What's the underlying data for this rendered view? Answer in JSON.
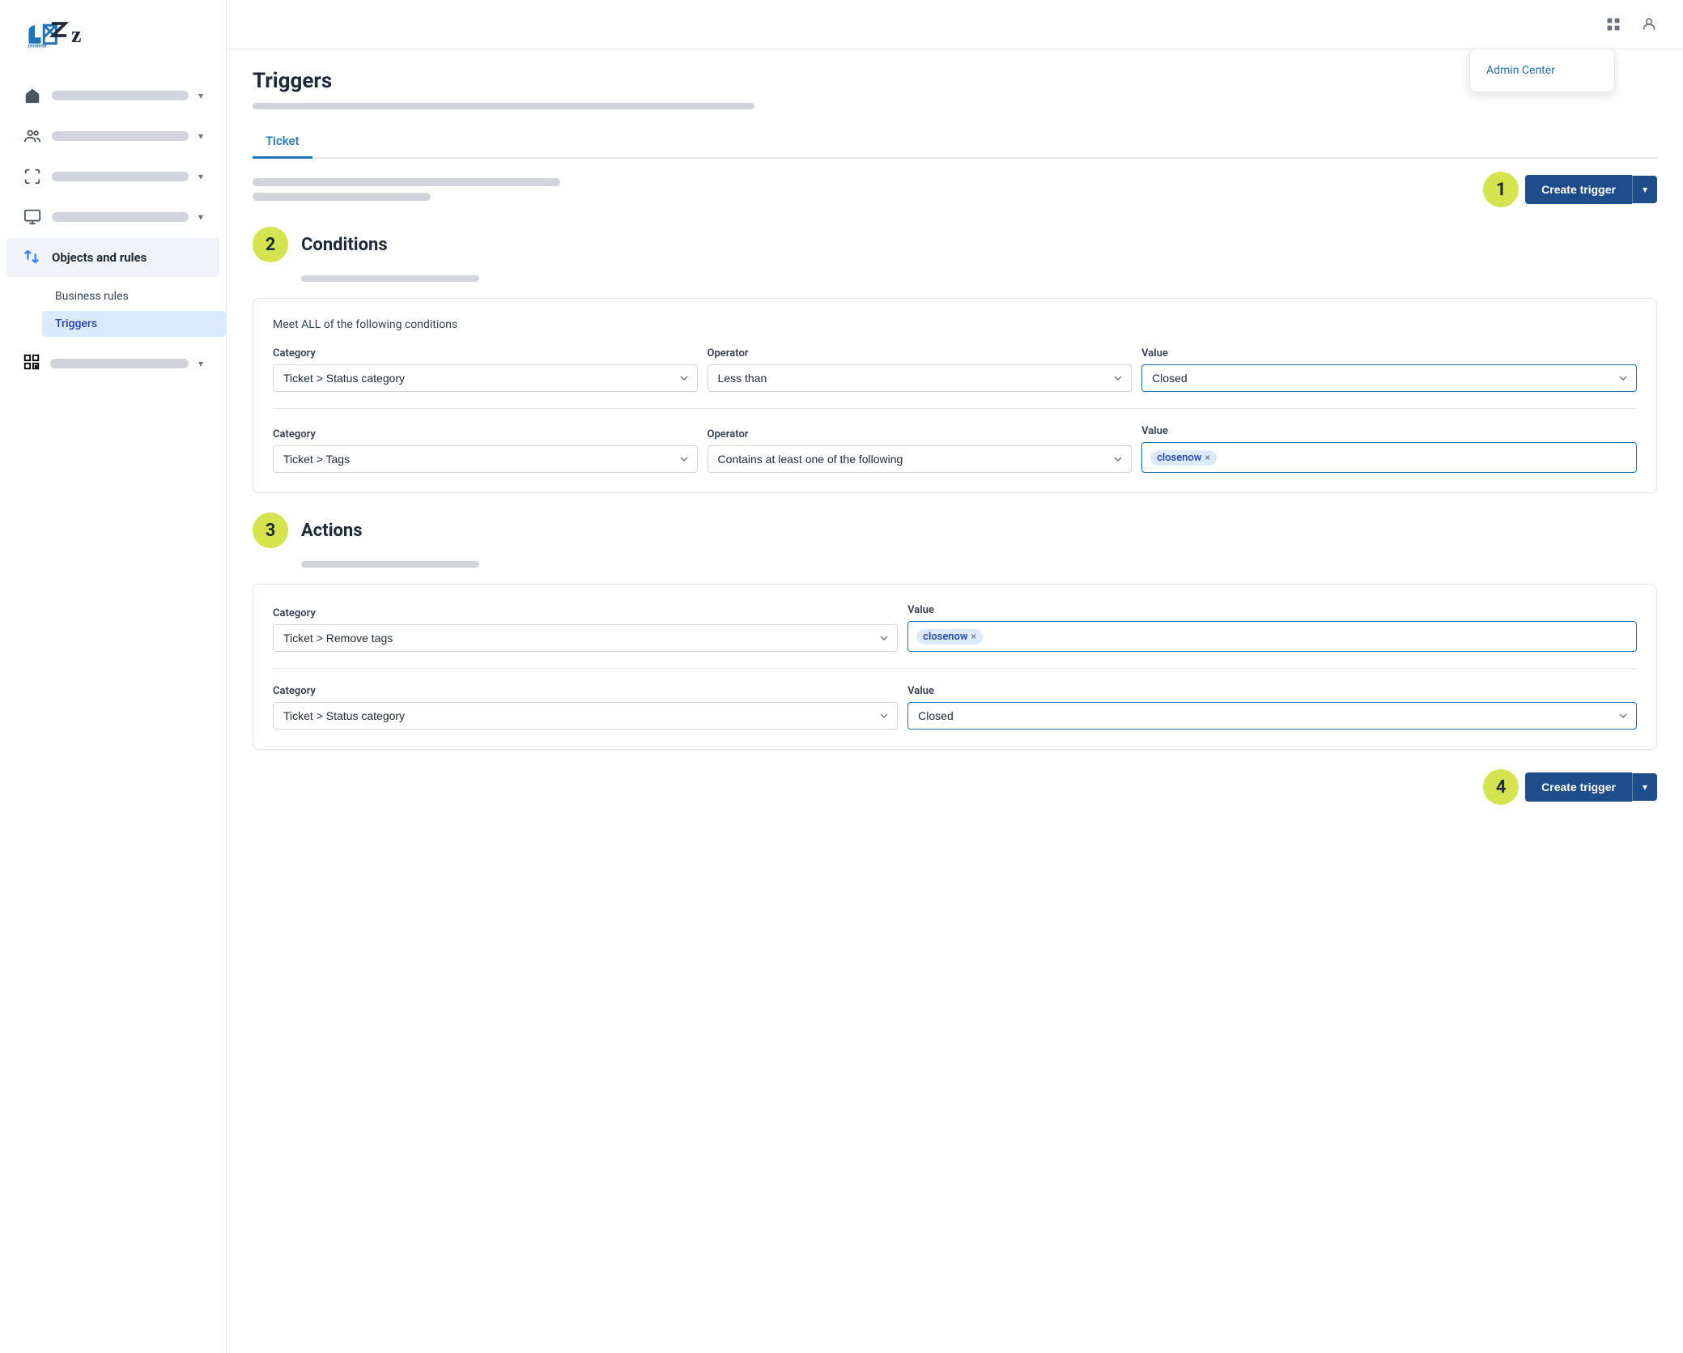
{
  "sidebar": {
    "logo_alt": "Zendesk logo",
    "nav_items": [
      {
        "id": "home",
        "icon": "🏢",
        "active": false
      },
      {
        "id": "people",
        "icon": "👥",
        "active": false
      },
      {
        "id": "channels",
        "icon": "↔",
        "active": false
      },
      {
        "id": "workspace",
        "icon": "🖥",
        "active": false
      },
      {
        "id": "objects-rules",
        "icon": "⇄",
        "label": "Objects and rules",
        "active": true
      },
      {
        "id": "apps",
        "icon": "⊞",
        "active": false
      }
    ],
    "sub_items": [
      {
        "id": "business-rules",
        "label": "Business rules",
        "active": false
      },
      {
        "id": "triggers",
        "label": "Triggers",
        "active": true
      }
    ]
  },
  "header": {
    "admin_center_label": "Admin Center",
    "grid_icon": "grid",
    "user_icon": "user"
  },
  "page": {
    "title": "Triggers",
    "tabs": [
      {
        "id": "ticket",
        "label": "Ticket",
        "active": true
      }
    ],
    "create_trigger_label": "Create trigger",
    "step1_badge": "1",
    "step2_badge": "2",
    "step3_badge": "3",
    "step4_badge": "4"
  },
  "conditions": {
    "section_title": "Conditions",
    "subtitle": "Meet ALL of the following conditions",
    "row1": {
      "category_label": "Category",
      "category_value": "Ticket > Status category",
      "operator_label": "Operator",
      "operator_value": "Less than",
      "value_label": "Value",
      "value_value": "Closed"
    },
    "row2": {
      "category_label": "Category",
      "category_value": "Ticket > Tags",
      "operator_label": "Operator",
      "operator_value": "Contains at least one of the following",
      "value_label": "Value",
      "tag_value": "closenow"
    }
  },
  "actions": {
    "section_title": "Actions",
    "row1": {
      "category_label": "Category",
      "category_value": "Ticket > Remove tags",
      "value_label": "Value",
      "tag_value": "closenow"
    },
    "row2": {
      "category_label": "Category",
      "category_value": "Ticket > Status category",
      "value_label": "Value",
      "value_value": "Closed"
    }
  }
}
